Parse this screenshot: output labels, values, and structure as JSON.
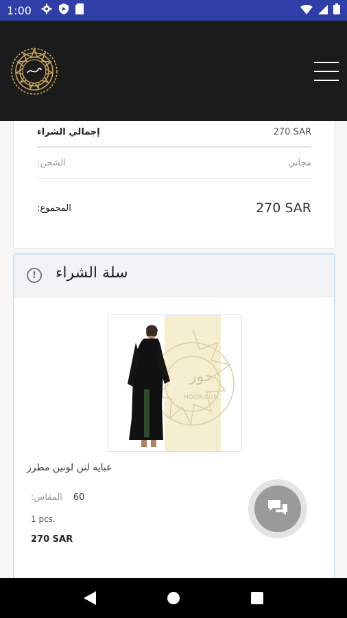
{
  "status_bar": {
    "time": "1:00",
    "icons": [
      "gear-icon",
      "shield-icon",
      "sd-card-icon",
      "wifi-icon",
      "signal-icon",
      "battery-icon"
    ]
  },
  "header": {
    "logo": "brand-logo",
    "menu_icon": "hamburger-menu-icon"
  },
  "summary": {
    "purchase_label": "إجمالي الشراء",
    "purchase_value": "270 SAR",
    "shipping_label": ":الشحن",
    "shipping_value": "مجاني",
    "total_label": ":المجموع",
    "total_value": "270 SAR"
  },
  "cart": {
    "title": "سلة الشراء",
    "info_icon": "info-icon",
    "item": {
      "name": "عبايه لنن لونين مطرز",
      "size_label": ":المقاس",
      "size_value": "60",
      "quantity": "1 pcs.",
      "price": "270 SAR"
    }
  },
  "chat_button": {
    "icon": "chat-bubbles-icon"
  },
  "nav_bar": {
    "icons": [
      "back-icon",
      "home-icon",
      "recents-icon"
    ]
  },
  "colors": {
    "status_bar": "#2f3ea8",
    "header_bg": "#1b1b1b",
    "logo_gold": "#c9a55c",
    "cart_border": "#cfe4f3",
    "fab_gray": "#9a9a9a"
  }
}
